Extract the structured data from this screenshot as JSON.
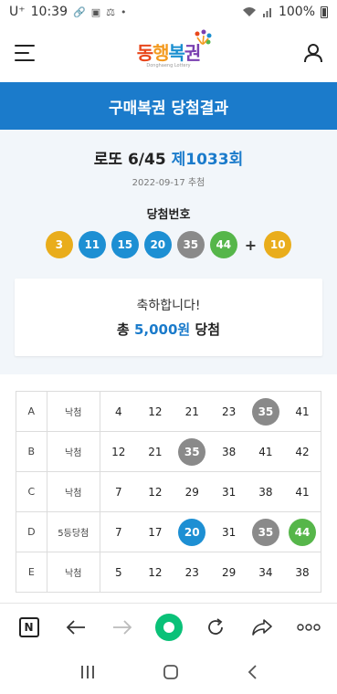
{
  "status_bar": {
    "carrier": "U⁺",
    "time": "10:39",
    "battery": "100%"
  },
  "header": {
    "logo_text": [
      "동",
      "행",
      "복",
      "권"
    ],
    "logo_sub": "Donghaeng Lottery"
  },
  "page_title": "구매복권 당첨결과",
  "draw": {
    "game": "로또 6/45",
    "round": "제1033회",
    "date": "2022-09-17 추첨",
    "win_label": "당첨번호",
    "numbers": [
      "3",
      "11",
      "15",
      "20",
      "35",
      "44"
    ],
    "bonus": "10",
    "plus": "+"
  },
  "result": {
    "congrats": "축하합니다!",
    "prefix": "총",
    "amount": "5,000원",
    "suffix": "당첨"
  },
  "tickets": [
    {
      "key": "A",
      "status": "낙첨",
      "numbers": [
        "4",
        "12",
        "21",
        "23",
        "35",
        "41"
      ],
      "matched": [
        false,
        false,
        false,
        false,
        true,
        false
      ]
    },
    {
      "key": "B",
      "status": "낙첨",
      "numbers": [
        "12",
        "21",
        "35",
        "38",
        "41",
        "42"
      ],
      "matched": [
        false,
        false,
        true,
        false,
        false,
        false
      ]
    },
    {
      "key": "C",
      "status": "낙첨",
      "numbers": [
        "7",
        "12",
        "29",
        "31",
        "38",
        "41"
      ],
      "matched": [
        false,
        false,
        false,
        false,
        false,
        false
      ]
    },
    {
      "key": "D",
      "status": "5등당첨",
      "numbers": [
        "7",
        "17",
        "20",
        "31",
        "35",
        "44"
      ],
      "matched": [
        false,
        false,
        true,
        false,
        true,
        true
      ]
    },
    {
      "key": "E",
      "status": "낙첨",
      "numbers": [
        "5",
        "12",
        "23",
        "29",
        "34",
        "38"
      ],
      "matched": [
        false,
        false,
        false,
        false,
        false,
        false
      ]
    }
  ],
  "toolbar": {
    "n_label": "N"
  },
  "colors": {
    "primary": "#1b7bcb",
    "ball_yellow": "#e9ad1c",
    "ball_blue": "#1d8fd3",
    "ball_gray": "#8a8a8a",
    "ball_green": "#56b64a",
    "naver_green": "#0ac178"
  }
}
